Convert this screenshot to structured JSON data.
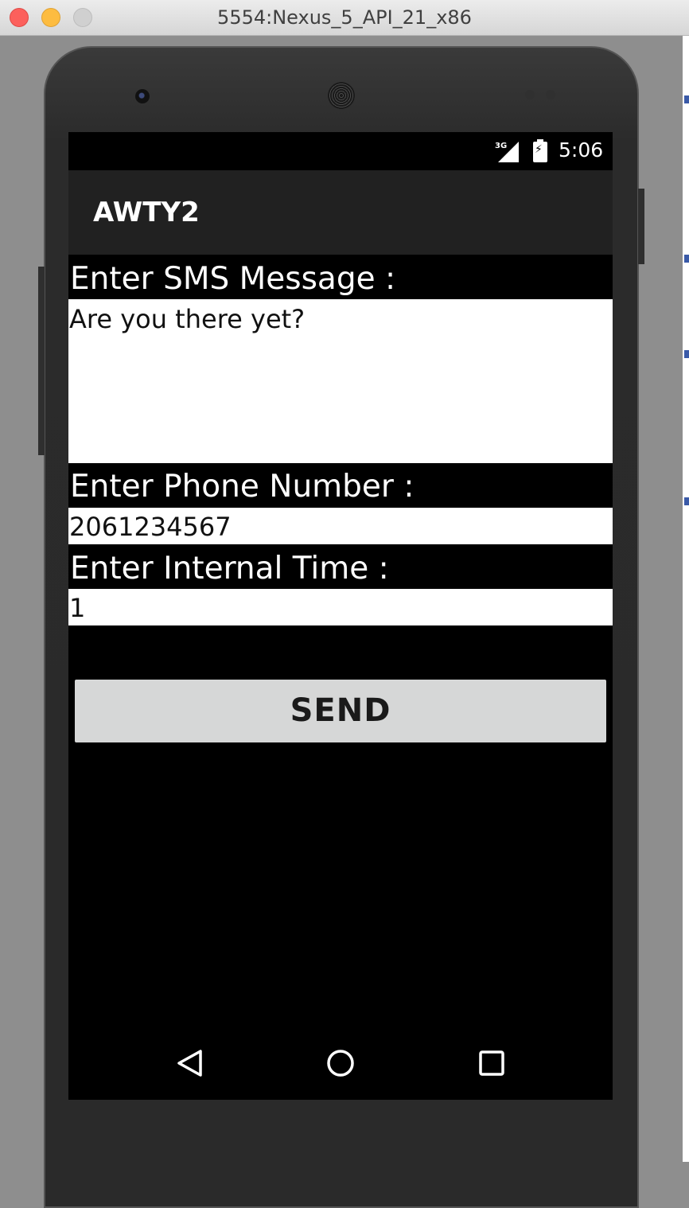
{
  "window": {
    "title": "5554:Nexus_5_API_21_x86"
  },
  "status_bar": {
    "network": "3G",
    "time": "5:06"
  },
  "action_bar": {
    "title": "AWTY2"
  },
  "form": {
    "sms_label": "Enter SMS Message :",
    "sms_value": "Are you there yet?",
    "phone_label": "Enter Phone Number :",
    "phone_value": "2061234567",
    "interval_label": "Enter Internal Time :",
    "interval_value": "1",
    "send_label": "SEND"
  },
  "nav_bar": {
    "back": "back-icon",
    "home": "home-icon",
    "recents": "recents-icon"
  }
}
